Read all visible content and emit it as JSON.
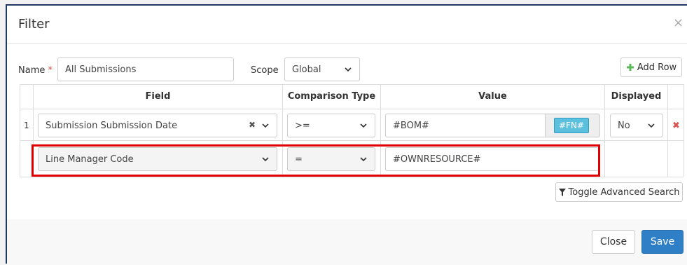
{
  "dialog": {
    "title": "Filter",
    "close_glyph": "×"
  },
  "form": {
    "name_label": "Name",
    "required_mark": "*",
    "name_value": "All Submissions",
    "scope_label": "Scope",
    "scope_value": "Global",
    "add_row_label": "Add Row"
  },
  "table": {
    "headers": {
      "field": "Field",
      "comparison": "Comparison Type",
      "value": "Value",
      "displayed": "Displayed"
    },
    "rows": [
      {
        "number": "1",
        "field": "Submission Submission Date",
        "clear_glyph": "✖",
        "comparison": ">=",
        "value": "#BOM#",
        "fn_label": "#FN#",
        "displayed": "No",
        "remove_glyph": "✖"
      },
      {
        "number": "",
        "field": "Line Manager Code",
        "comparison": "=",
        "value": "#OWNRESOURCE#"
      }
    ]
  },
  "toggle_advanced_label": "Toggle Advanced Search",
  "footer": {
    "close_label": "Close",
    "save_label": "Save"
  },
  "colors": {
    "accent": "#2f7fc7",
    "fn_button": "#5bc0de",
    "required": "#d9534f",
    "highlight": "#e00000",
    "add_icon": "#5cb85c"
  },
  "icons": [
    "close-icon",
    "plus-icon",
    "chevron-down-icon",
    "clear-icon",
    "remove-icon",
    "filter-icon"
  ]
}
